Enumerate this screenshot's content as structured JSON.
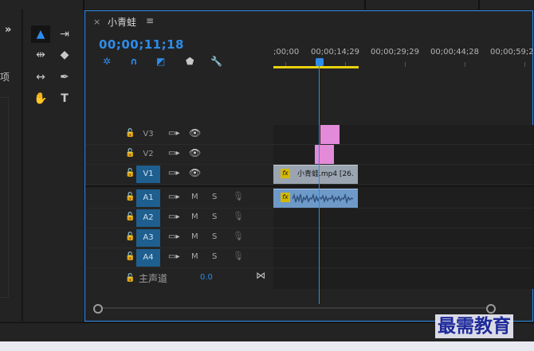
{
  "left_panel": {
    "expand_glyph": "»",
    "partial_label": "项"
  },
  "tools": [
    {
      "name": "selection-tool",
      "glyph": "▲",
      "selected": true
    },
    {
      "name": "track-select-forward-tool",
      "glyph": "⇥"
    },
    {
      "name": "ripple-edit-tool",
      "glyph": "⇹"
    },
    {
      "name": "razor-tool",
      "glyph": "◆"
    },
    {
      "name": "slip-tool",
      "glyph": "↔"
    },
    {
      "name": "pen-tool",
      "glyph": "✒"
    },
    {
      "name": "hand-tool",
      "glyph": "✋"
    },
    {
      "name": "type-tool",
      "glyph": "T"
    }
  ],
  "timeline": {
    "close_glyph": "×",
    "sequence_name": "小青蛙",
    "menu_glyph": "≡",
    "timecode": "00;00;11;18",
    "ruler_labels": [
      ";00;00",
      "00;00;14;29",
      "00;00;29;29",
      "00;00;44;28",
      "00;00;59;28"
    ],
    "video_tracks": [
      "V3",
      "V2",
      "V1"
    ],
    "audio_tracks": [
      "A1",
      "A2",
      "A3",
      "A4"
    ],
    "mute_label": "M",
    "solo_label": "S",
    "master": {
      "label": "主声道",
      "value": "0.0"
    },
    "clip": {
      "fx": "fx",
      "label": "小青蛙.mp4 [26."
    }
  },
  "watermark": "最需教育",
  "colors": {
    "accent": "#2d8ceb",
    "clip_pink": "#e38ad8",
    "audio_clip": "#6e9ac9",
    "work_area": "#e8d20f",
    "track_active": "#1f5f8f"
  }
}
